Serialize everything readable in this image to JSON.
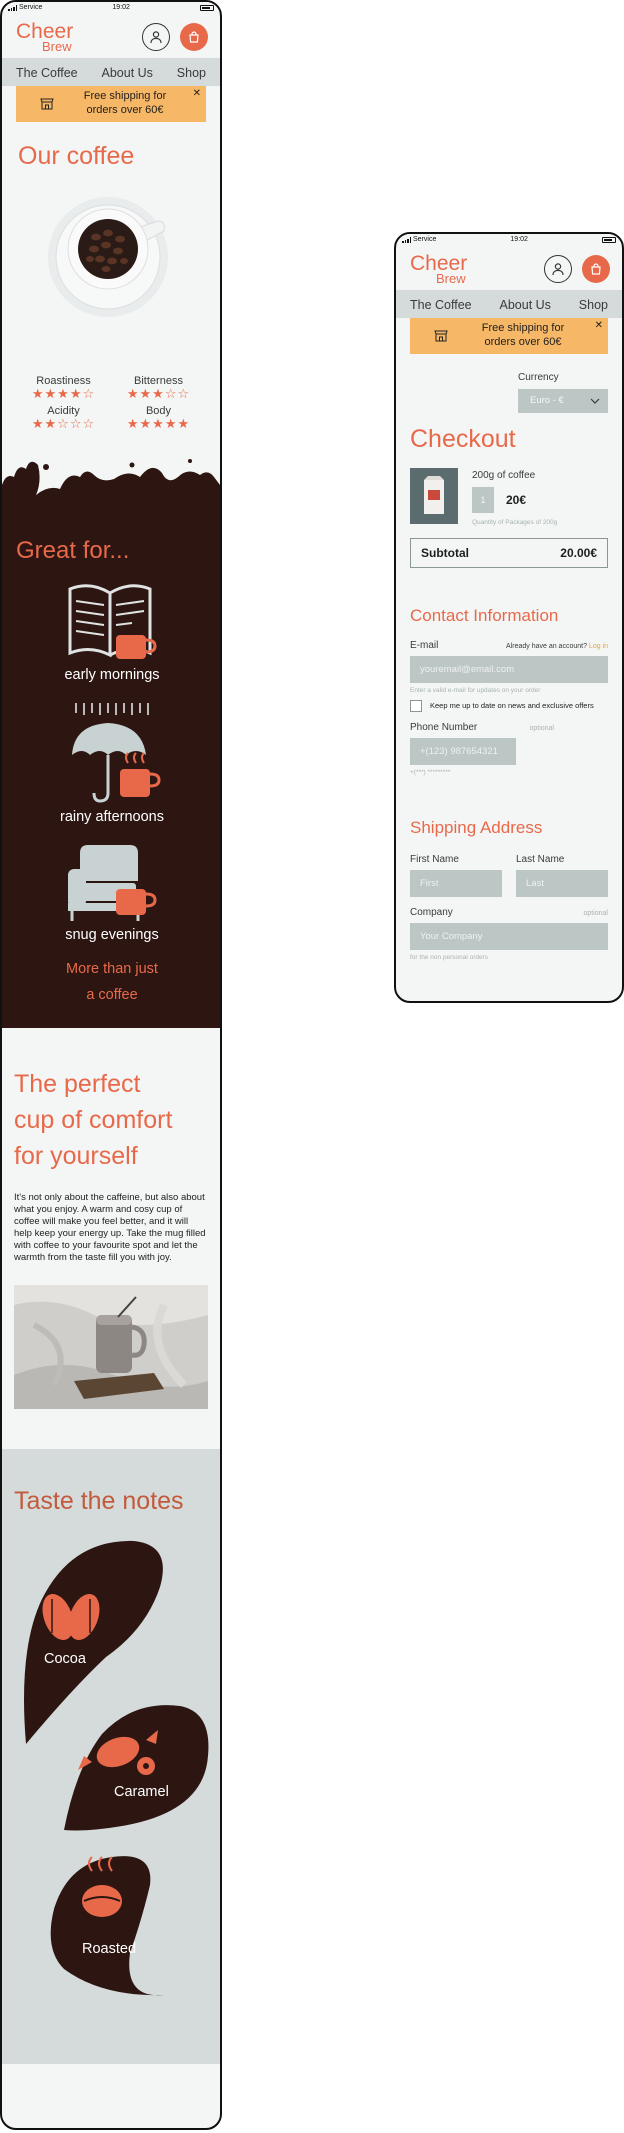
{
  "status": {
    "carrier": "Service",
    "time": "19:02"
  },
  "brand": {
    "logo_line1": "Cheer",
    "logo_line2": "Brew",
    "accent": "#e8694a",
    "dark": "#2d1611",
    "banner": "#f6b866"
  },
  "nav": {
    "items": [
      "The Coffee",
      "About Us",
      "Shop"
    ]
  },
  "banner": {
    "line1": "Free shipping for",
    "line2": "orders over 60€",
    "close": "✕"
  },
  "coffee": {
    "title": "Our coffee",
    "ratings": [
      {
        "label": "Roastiness",
        "stars": 4,
        "max": 5
      },
      {
        "label": "Bitterness",
        "stars": 3,
        "max": 5
      },
      {
        "label": "Acidity",
        "stars": 2,
        "max": 5
      },
      {
        "label": "Body",
        "stars": 5,
        "max": 5
      }
    ]
  },
  "great": {
    "title": "Great for...",
    "items": [
      {
        "caption": "early mornings",
        "icon": "newspaper-icon"
      },
      {
        "caption": "rainy afternoons",
        "icon": "umbrella-icon"
      },
      {
        "caption": "snug evenings",
        "icon": "armchair-icon"
      }
    ],
    "more_line1": "More than just",
    "more_line2": "a coffee"
  },
  "comfort": {
    "title_line1": "The perfect",
    "title_line2": "cup of comfort",
    "title_line3": "for yourself",
    "body": "It's not only about the caffeine, but also about what you enjoy. A warm and cosy cup of coffee will make you feel better, and it will help keep your energy up. Take the mug filled with coffee to your favourite spot and let the warmth from the taste fill you with joy."
  },
  "notes": {
    "title": "Taste the notes",
    "items": [
      {
        "label": "Cocoa",
        "icon": "cocoa-pod-icon"
      },
      {
        "label": "Caramel",
        "icon": "caramel-candy-icon"
      },
      {
        "label": "Roasted",
        "icon": "coffee-bean-icon"
      }
    ]
  },
  "checkout": {
    "currency_label": "Currency",
    "currency_value": "Euro - €",
    "title": "Checkout",
    "product": {
      "name": "200g of coffee",
      "qty": "1",
      "price": "20€",
      "qty_hint": "Quantity of Packages of 200g"
    },
    "subtotal_label": "Subtotal",
    "subtotal_value": "20.00€",
    "contact": {
      "title": "Contact Information",
      "email_label": "E-mail",
      "account_prompt": "Already have an account?",
      "login_link": "Log in",
      "email_placeholder": "youremail@email.com",
      "email_hint": "Enter a valid e-mail for updates on your order",
      "newsletter_label": "Keep me up to date on news and exclusive offers",
      "phone_label": "Phone Number",
      "phone_optional": "optional",
      "phone_placeholder": "+(123) 987654321",
      "phone_hint": "+(***) *********"
    },
    "shipping": {
      "title": "Shipping Address",
      "first_label": "First Name",
      "first_placeholder": "First",
      "last_label": "Last Name",
      "last_placeholder": "Last",
      "company_label": "Company",
      "company_optional": "optional",
      "company_placeholder": "Your Company",
      "company_hint": "for the non personal orders"
    }
  }
}
